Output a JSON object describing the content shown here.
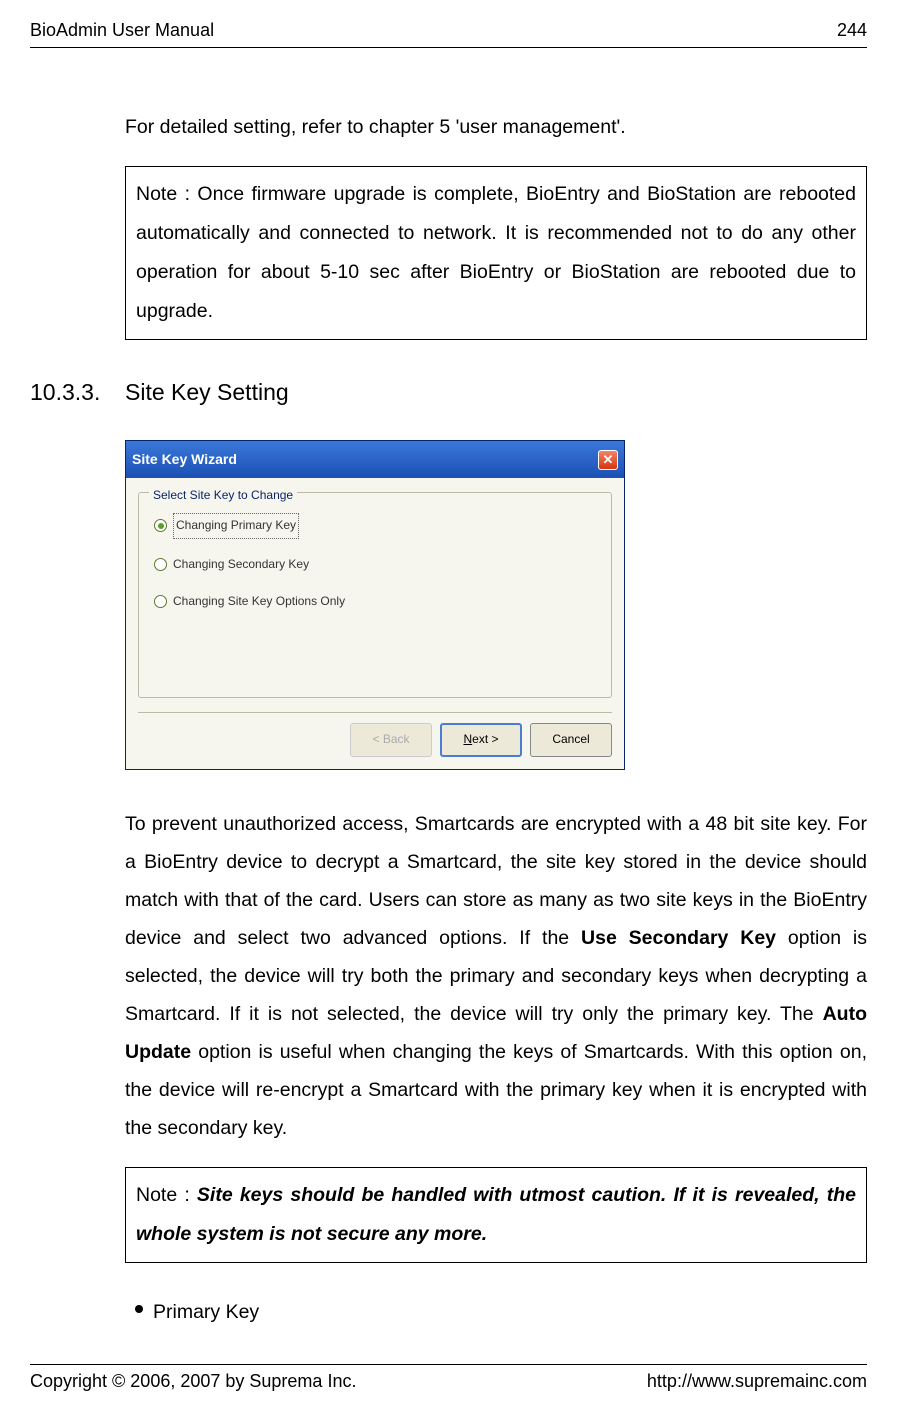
{
  "header": {
    "left": "BioAdmin  User  Manual",
    "right": "244"
  },
  "intro": "For detailed setting, refer to chapter 5 'user management'.",
  "note1": "Note : Once firmware upgrade is complete, BioEntry and BioStation are rebooted automatically and connected to network. It is recommended not to do any other operation for about 5-10 sec after BioEntry or BioStation are rebooted due to upgrade.",
  "section": {
    "num": "10.3.3.",
    "title": "Site Key Setting"
  },
  "dialog": {
    "title": "Site Key Wizard",
    "close_glyph": "✕",
    "group_legend": "Select Site Key to Change",
    "options": [
      {
        "label": "Changing Primary Key",
        "selected": true
      },
      {
        "label": "Changing Secondary Key",
        "selected": false
      },
      {
        "label": "Changing Site Key Options Only",
        "selected": false
      }
    ],
    "buttons": {
      "back": "< Back",
      "next": "Next >",
      "cancel": "Cancel"
    }
  },
  "body_pre": "To prevent unauthorized access, Smartcards are encrypted with a 48 bit site key. For a BioEntry device to decrypt a Smartcard, the site key stored in the device should match with that of the card. Users can store as many as two site keys in the BioEntry device and select two advanced options. If the ",
  "body_bold1": "Use Secondary Key",
  "body_mid": " option is selected, the device will try both the primary and secondary keys when decrypting a Smartcard. If it is not selected, the device will try only the primary key. The ",
  "body_bold2": "Auto Update",
  "body_post": " option is useful when changing the keys of Smartcards. With this option on, the device will re-encrypt a Smartcard with the primary key when it is encrypted with the secondary key.",
  "note2_pre": "Note : ",
  "note2_bold": "Site keys should be handled with utmost caution. If it is revealed, the whole system is not secure any more.",
  "bullet1": "Primary Key",
  "footer": {
    "left": "Copyright © 2006, 2007 by Suprema Inc.",
    "right": "http://www.supremainc.com"
  }
}
